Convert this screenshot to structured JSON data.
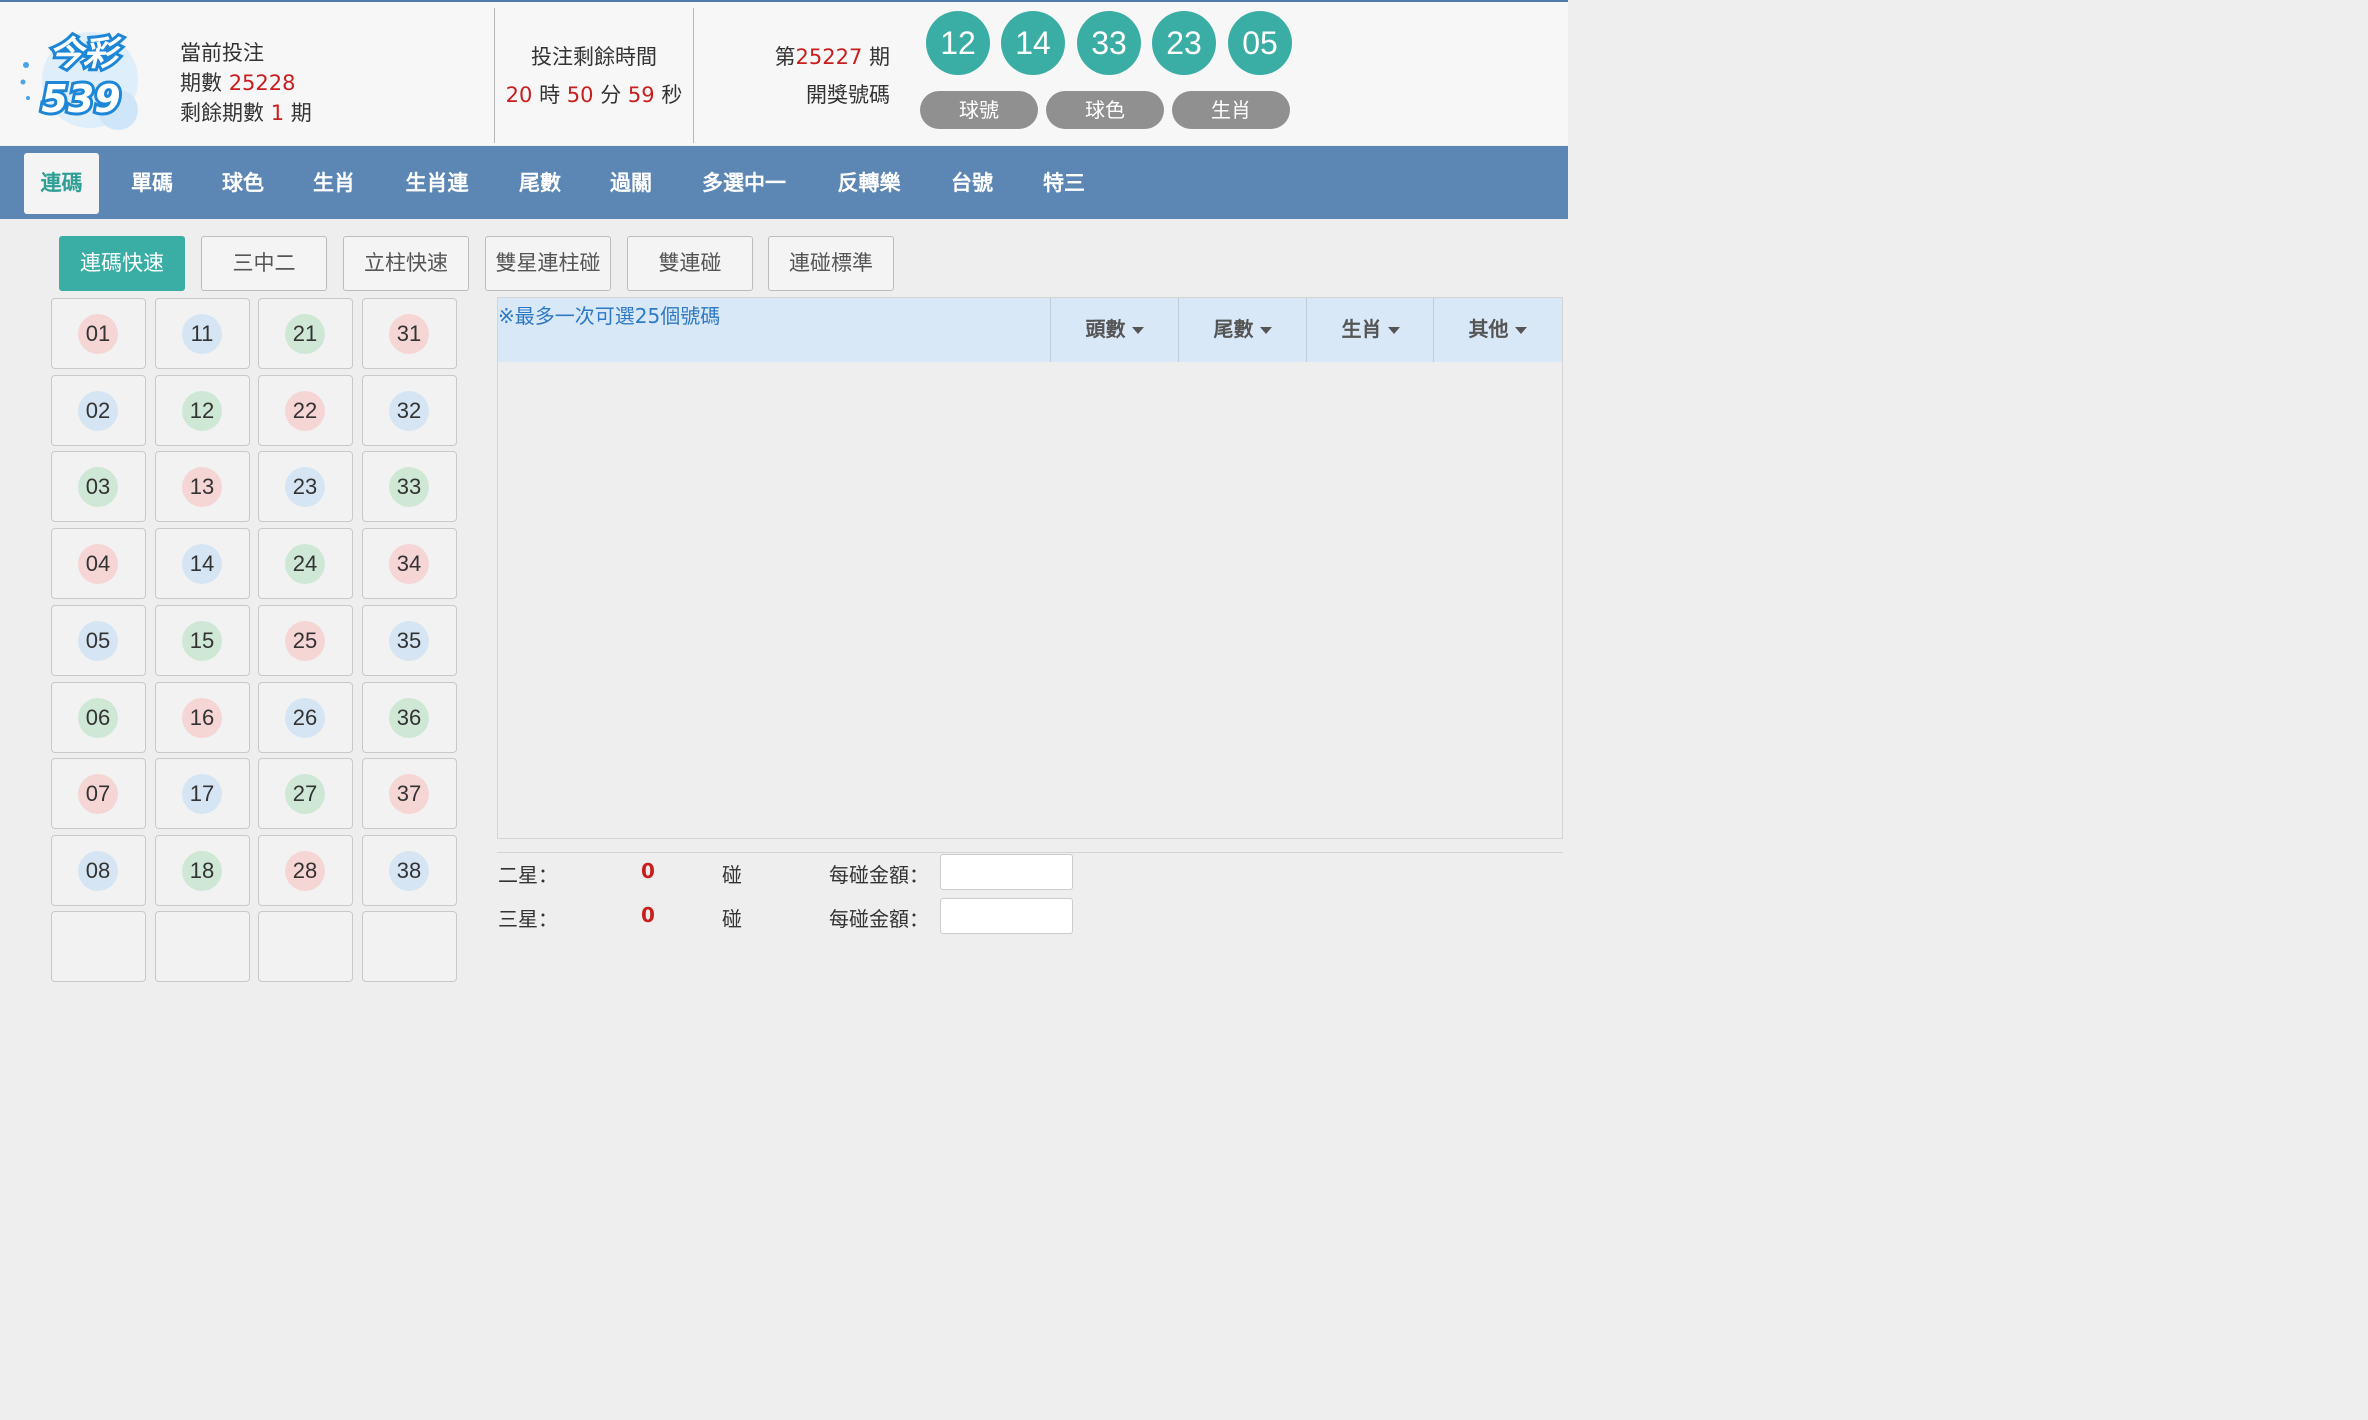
{
  "logo": {
    "text_top": "今彩",
    "text_bottom": "539"
  },
  "current": {
    "label": "當前投注",
    "period_label": "期數",
    "period": "25228",
    "remaining_label": "剩餘期數",
    "remaining": "1",
    "remaining_unit": "期"
  },
  "countdown": {
    "label": "投注剩餘時間",
    "hours": "20",
    "h_unit": "時",
    "minutes": "50",
    "m_unit": "分",
    "seconds": "59",
    "s_unit": "秒"
  },
  "last_draw": {
    "prefix": "第",
    "period": "25227",
    "suffix": " 期",
    "label": "開獎號碼",
    "balls": [
      "12",
      "14",
      "33",
      "23",
      "05"
    ],
    "ball_color": "#3aaea4"
  },
  "view_toggles": [
    "球號",
    "球色",
    "生肖"
  ],
  "nav": [
    "連碼",
    "單碼",
    "球色",
    "生肖",
    "生肖連",
    "尾數",
    "過關",
    "多選中一",
    "反轉樂",
    "台號",
    "特三"
  ],
  "sub_tabs": [
    "連碼快速",
    "三中二",
    "立柱快速",
    "雙星連柱碰",
    "雙連碰",
    "連碰標準"
  ],
  "numbers": [
    [
      "01",
      "11",
      "21",
      "31"
    ],
    [
      "02",
      "12",
      "22",
      "32"
    ],
    [
      "03",
      "13",
      "23",
      "33"
    ],
    [
      "04",
      "14",
      "24",
      "34"
    ],
    [
      "05",
      "15",
      "25",
      "35"
    ],
    [
      "06",
      "16",
      "26",
      "36"
    ],
    [
      "07",
      "17",
      "27",
      "37"
    ],
    [
      "08",
      "18",
      "28",
      "38"
    ]
  ],
  "number_colors": [
    [
      "red",
      "blue",
      "green",
      "red"
    ],
    [
      "blue",
      "green",
      "red",
      "blue"
    ],
    [
      "green",
      "red",
      "blue",
      "green"
    ],
    [
      "red",
      "blue",
      "green",
      "red"
    ],
    [
      "blue",
      "green",
      "red",
      "blue"
    ],
    [
      "green",
      "red",
      "blue",
      "green"
    ],
    [
      "red",
      "blue",
      "green",
      "red"
    ],
    [
      "blue",
      "green",
      "red",
      "blue"
    ]
  ],
  "ball_palette": {
    "red": "#f6d5d5",
    "blue": "#d5e5f3",
    "green": "#cfe8d6"
  },
  "panel": {
    "notice": "※最多一次可選25個號碼",
    "filters": [
      "頭數",
      "尾數",
      "生肖",
      "其他"
    ]
  },
  "stats": [
    {
      "label": "二星：",
      "count": "0",
      "unit": "碰",
      "amount_label": "每碰金額：",
      "amount": ""
    },
    {
      "label": "三星：",
      "count": "0",
      "unit": "碰",
      "amount_label": "每碰金額：",
      "amount": ""
    }
  ],
  "accent_color": "#3aaea4",
  "nav_color": "#5c86b3"
}
